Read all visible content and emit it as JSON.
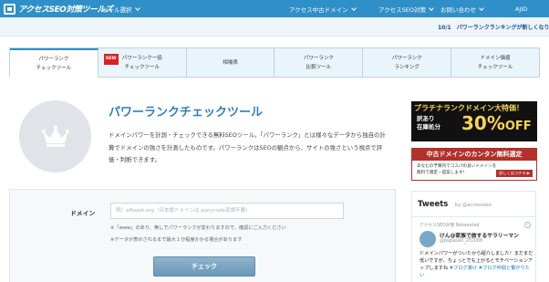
{
  "header": {
    "logo_text": "アクセスSEO対策ツールズ",
    "nav": [
      {
        "label": "ツール選択"
      },
      {
        "label": "アクセス中古ドメイン"
      },
      {
        "label": "アクセスSEO対策"
      },
      {
        "label": "お問い合わせ"
      },
      {
        "label": "AJID"
      }
    ]
  },
  "ticker": {
    "text": "10/1　パワーランクランキングが新しくなりま"
  },
  "tabs": [
    {
      "label": "パワーランク\nチェックツール",
      "active": true
    },
    {
      "label": "パワーランク一括\nチェックツール",
      "badge": "NEW"
    },
    {
      "label": "相場表"
    },
    {
      "label": "パワーランク\n比較ツール"
    },
    {
      "label": "パワーランク\nランキング"
    },
    {
      "label": "ドメイン価値\nチェックツール"
    }
  ],
  "hero": {
    "title": "パワーランクチェックツール",
    "description": "ドメインパワーを計測・チェックできる無料SEOツール。「パワーランク」とは様々なデータから独自の計算でドメインの強さを計測したものです。パワーランクはSEOの観点から、サイトの強さという視点で評価・判断できます。"
  },
  "form": {
    "domain_label": "ドメイン",
    "domain_placeholder": "例）afbweb.org（日本語ドメインは punycode変換不要）",
    "domain_value": "",
    "note1": "※「www」のあり、無しでパワーランクが変わりますので、確認にご入力ください",
    "note2": "※データが表示されるまで最大１分程度かかる場合があります",
    "submit_label": "チェック"
  },
  "banners": {
    "sale": {
      "top": "プラチナランクドメイン大特価！",
      "sub": "訳あり\n在庫処分",
      "big": "30%",
      "big_suffix": "OFF"
    },
    "guide": {
      "title": "中古ドメインのカンタン無料選定",
      "line1": "あなたの予算内でコスパの良いドメインを",
      "line2": "無料で選定・提案します！",
      "button": "詳しくはコチラ ▶"
    }
  },
  "tweets": {
    "title": "Tweets",
    "by": "by @accessseo",
    "retweet": "アクセスSEO対策 Retweeted",
    "name": "けん@家族で旅するサラリーマン",
    "handle": "@papasaki_202008",
    "body": "ドメインパワーがついたから紹介しました！まだまだ低いですが、ちょっとでも上がるとモチベーションアップしますね",
    "tags": "#ブログ書け #ブログ仲間と繋がりたい"
  }
}
